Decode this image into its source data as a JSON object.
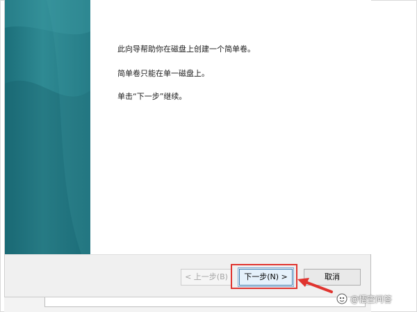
{
  "wizard": {
    "intro_lines": [
      "此向导帮助你在磁盘上创建一个简单卷。",
      "简单卷只能在单一磁盘上。",
      "单击“下一步”继续。"
    ]
  },
  "footer": {
    "back_label": "< 上一步(B)",
    "next_label": "下一步(N) >",
    "cancel_label": "取消"
  },
  "watermark": {
    "text": "@悟空问答"
  },
  "colors": {
    "banner": "#2f8a93",
    "highlight": "#e0342f",
    "next_button_border": "#3c7fb1"
  }
}
